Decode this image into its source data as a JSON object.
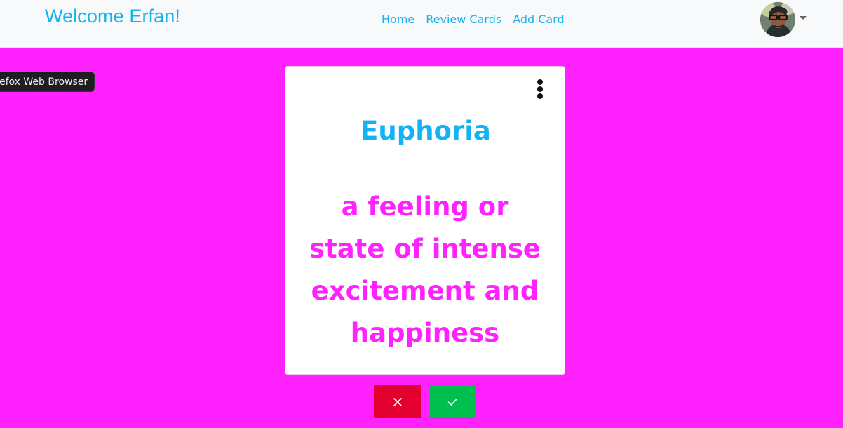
{
  "header": {
    "title": "Welcome Erfan!",
    "nav_items": [
      "Home",
      "Review Cards",
      "Add Card"
    ],
    "profile_icon": "avatar-icon",
    "dropdown_icon": "caret-down-icon"
  },
  "tooltip": {
    "text": "efox Web Browser"
  },
  "card": {
    "word": "Euphoria",
    "definition": "a feeling or state of intense excitement and happiness",
    "menu_icon": "kebab-menu-icon"
  },
  "actions": {
    "reject_icon": "close-icon",
    "accept_icon": "check-icon"
  },
  "colors": {
    "page_background": "#ff22ff",
    "navbar_background": "#f8f9fa",
    "accent_blue": "#12b2f4",
    "definition_pink": "#ff22ff",
    "reject_red": "#e3002f",
    "accept_green": "#00bf4f",
    "tooltip_background": "#1f1d22"
  }
}
